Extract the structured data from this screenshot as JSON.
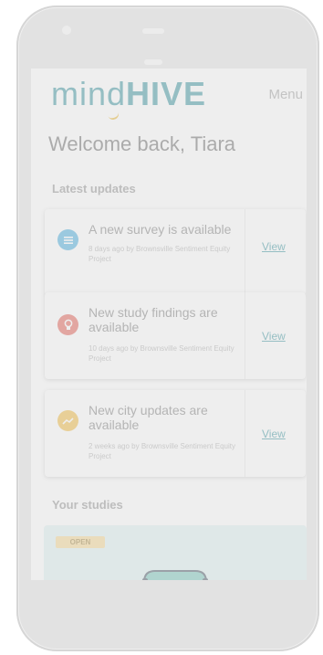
{
  "app": {
    "logo_part1": "mind",
    "logo_part2": "HIVE",
    "menu_label": "Menu",
    "welcome": "Welcome back, Tiara"
  },
  "sections": {
    "updates_title": "Latest updates",
    "studies_title": "Your studies"
  },
  "updates": [
    {
      "title": "A new survey is available",
      "meta": "8 days ago by Brownsville Sentiment Equity Project",
      "view_label": "View",
      "icon": "list-icon",
      "icon_color": "#3aa8dc"
    },
    {
      "title": "New study findings are available",
      "meta": "10 days ago by Brownsville Sentiment Equity Project",
      "view_label": "View",
      "icon": "lightbulb-icon",
      "icon_color": "#e2544a"
    },
    {
      "title": "New city updates are available",
      "meta": "2 weeks ago by Brownsville Sentiment Equity Project",
      "view_label": "View",
      "icon": "trend-icon",
      "icon_color": "#f2b632"
    }
  ],
  "study": {
    "status_badge": "OPEN"
  },
  "colors": {
    "brand": "#2c8f9a",
    "accent": "#e9b120",
    "study_bg": "#dcf1f1"
  }
}
